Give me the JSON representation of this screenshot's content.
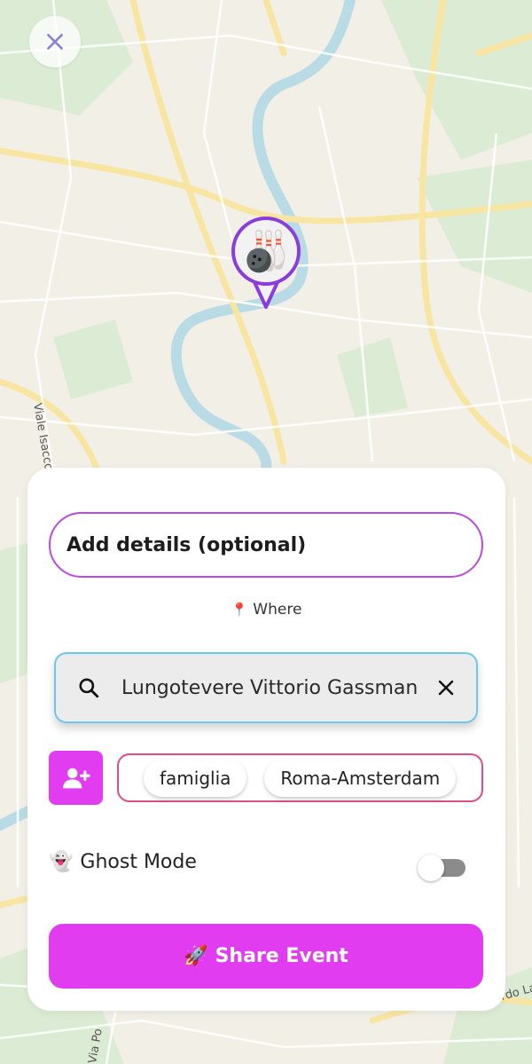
{
  "map": {
    "street_labels": [
      "Viale Isacco",
      "Via Po",
      "rdo La"
    ],
    "pin_icon": "bowling-icon",
    "pin_emoji": "🎳"
  },
  "close_icon": "close-icon",
  "panel": {
    "details_placeholder": "Add details (optional)",
    "where_icon": "📍",
    "where_label": "Where",
    "search_value": "Lungotevere Vittorio Gassman",
    "tags": [
      "famiglia",
      "Roma-Amsterdam"
    ],
    "ghost_icon": "👻",
    "ghost_label": "Ghost Mode",
    "ghost_enabled": false,
    "share_icon": "🚀",
    "share_label": "Share Event"
  },
  "colors": {
    "accent": "#e23cf0",
    "pin_border": "#8a3ddb",
    "tags_border": "#e04c86",
    "search_border": "#6cc7e8"
  }
}
